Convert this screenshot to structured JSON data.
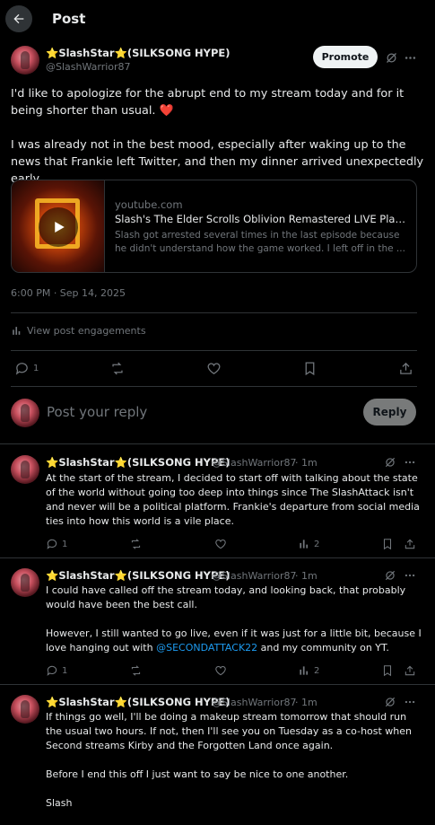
{
  "header": {
    "title": "Post"
  },
  "post": {
    "author": {
      "name": "⭐SlashStar⭐(SILKSONG HYPE)",
      "handle": "@SlashWarrior87"
    },
    "promote_label": "Promote",
    "text_p1": "I'd like to apologize for the abrupt end to my stream today and for it being shorter than usual. ❤️",
    "text_p2": "I was already not in the best mood, especially after waking up to the news that Frankie left Twitter, and then my dinner arrived unexpectedly early.",
    "card": {
      "domain": "youtube.com",
      "title": "Slash's The Elder Scrolls Oblivion Remastered LIVE Playthrough...",
      "description": "Slash got arrested several times in the last episode because he didn't understand how the game worked. I left off in the ..."
    },
    "timestamp": "6:00 PM · Sep 14, 2025",
    "engagements_label": "View post engagements",
    "reply_count": "1"
  },
  "composer": {
    "placeholder": "Post your reply",
    "reply_label": "Reply"
  },
  "replies": [
    {
      "name": "⭐SlashStar⭐(SILKSONG HYPE)",
      "handle": "@SlashWarrior87",
      "time": "· 1m",
      "paragraphs": [
        "At the start of the stream, I decided to start off with talking about the state of the world without going too deep into things since The SlashAttack isn't and never will be a political platform. Frankie's departure from social media ties into how this world is a vile place."
      ],
      "replies": "1",
      "views": "2"
    },
    {
      "name": "⭐SlashStar⭐(SILKSONG HYPE)",
      "handle": "@SlashWarrior87",
      "time": "· 1m",
      "p1": "I could have called off the stream today, and looking back, that probably would have been the best call.",
      "p2_before": "However, I still wanted to go live, even if it was just for a little bit, because I love hanging out with ",
      "p2_mention": "@SECONDATTACK22",
      "p2_after": " and my community on YT.",
      "replies": "1",
      "views": "2"
    },
    {
      "name": "⭐SlashStar⭐(SILKSONG HYPE)",
      "handle": "@SlashWarrior87",
      "time": "· 1m",
      "p1": "If things go well, I'll be doing a makeup stream tomorrow that should run the usual two hours. If not, then I'll see you on Tuesday as a co-host when Second streams Kirby and the Forgotten Land once again.",
      "p2": "Before I end this off I just want to say be nice to one another.",
      "p3": "Slash"
    }
  ],
  "icons": {
    "back": "arrow-left-icon",
    "grok": "grok-icon",
    "more": "more-icon",
    "reply": "reply-icon",
    "repost": "repost-icon",
    "like": "like-icon",
    "bookmark": "bookmark-icon",
    "share": "share-icon",
    "views": "views-icon"
  },
  "colors": {
    "background": "#000000",
    "text": "#e7e9ea",
    "muted": "#71767b",
    "accent": "#1d9bf0",
    "divider": "#2f3336"
  }
}
